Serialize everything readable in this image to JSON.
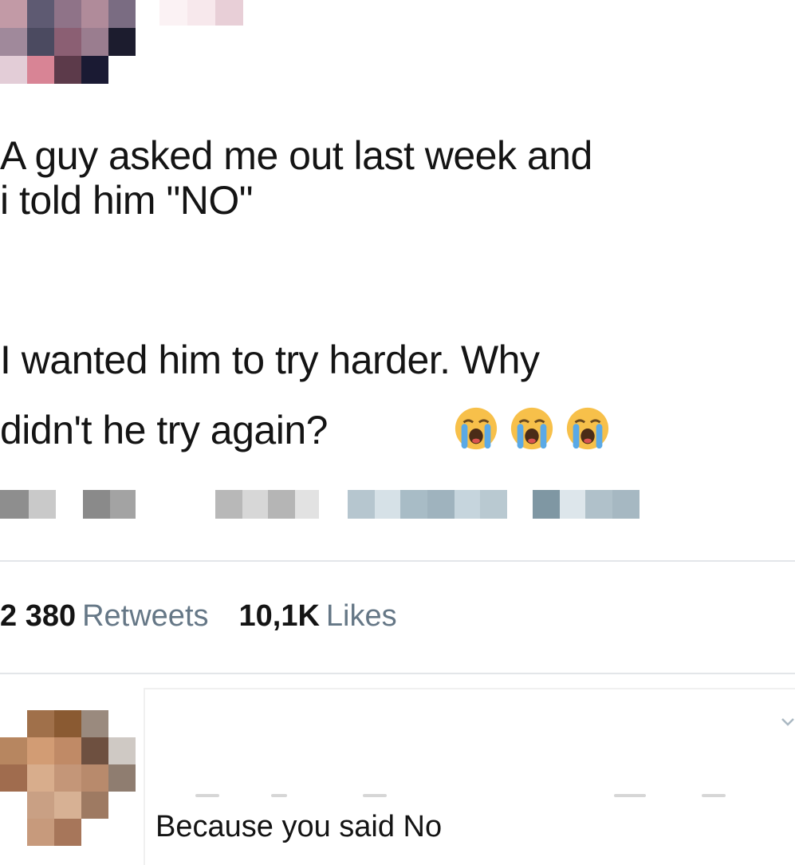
{
  "tweet": {
    "text_lines": [
      "A guy asked me out last week and",
      "i told him \"NO\"",
      "I wanted him to try harder. Why",
      "didn't he try again?"
    ],
    "emojis": [
      "loudly-crying-face-icon",
      "loudly-crying-face-icon",
      "loudly-crying-face-icon"
    ],
    "retweets_count": "2 380",
    "retweets_label": "Retweets",
    "likes_count": "10,1K",
    "likes_label": "Likes"
  },
  "reply": {
    "text": "Because you said No"
  },
  "colors": {
    "text": "#141414",
    "secondary_text": "#657786",
    "divider": "#e3e6e9",
    "emoji_face": "#f7c04a",
    "emoji_tears": "#5aa9e6"
  }
}
